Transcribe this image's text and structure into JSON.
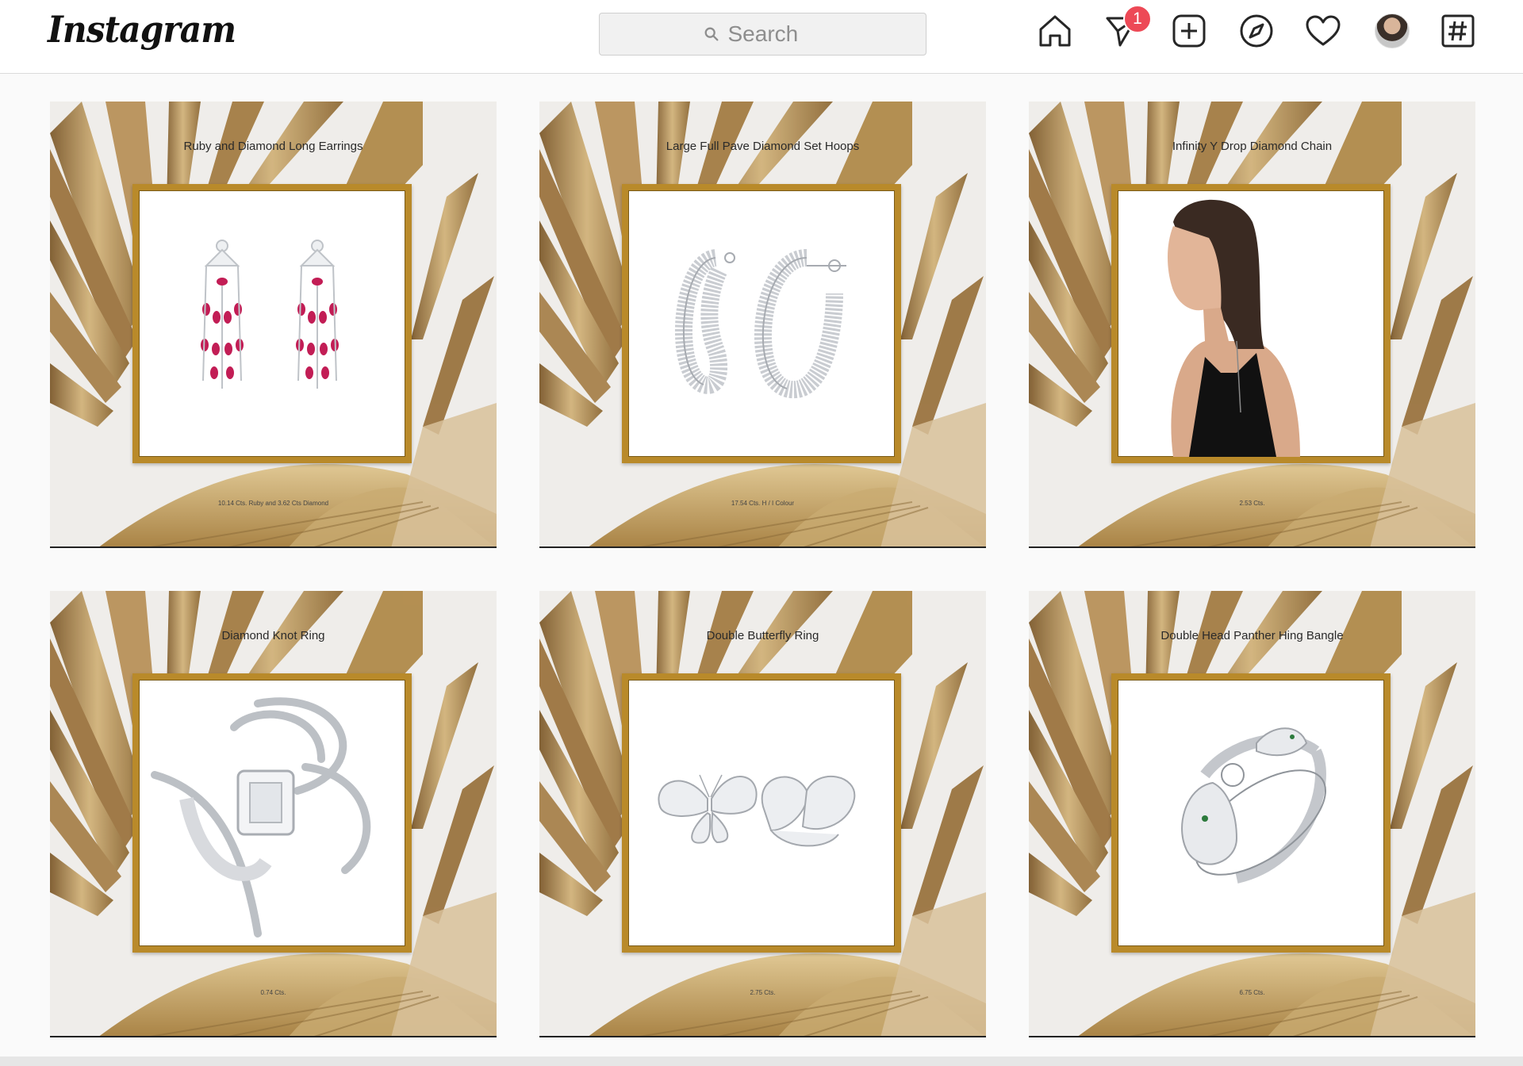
{
  "header": {
    "logo_text": "Instagram",
    "search_placeholder": "Search",
    "notification_count": "1",
    "badge_color": "#ed4956",
    "icons": [
      "home-icon",
      "direct-messages-icon",
      "new-post-icon",
      "explore-icon",
      "activity-heart-icon",
      "profile-avatar",
      "hashtag-icon"
    ]
  },
  "posts": [
    {
      "title": "Ruby and Diamond Long Earrings",
      "caption": "10.14 Cts. Ruby and 3.62 Cts Diamond",
      "image": "ruby-chandelier-earrings"
    },
    {
      "title": "Large Full Pave Diamond Set Hoops",
      "caption": "17.54 Cts. H / I Colour",
      "image": "pave-diamond-hoops"
    },
    {
      "title": "Infinity Y Drop Diamond Chain",
      "caption": "2.53 Cts.",
      "image": "model-wearing-drop-chain"
    },
    {
      "title": "Diamond Knot Ring",
      "caption": "0.74 Cts.",
      "image": "diamond-knot-ring"
    },
    {
      "title": "Double Butterfly Ring",
      "caption": "2.75 Cts.",
      "image": "double-butterfly-ring"
    },
    {
      "title": "Double Head Panther Hing Bangle",
      "caption": "6.75 Cts.",
      "image": "panther-bangle"
    }
  ],
  "colors": {
    "frame_gold": "#b98a2a",
    "leaf_gold": "#b08a4a",
    "tile_bg": "#efedea"
  }
}
